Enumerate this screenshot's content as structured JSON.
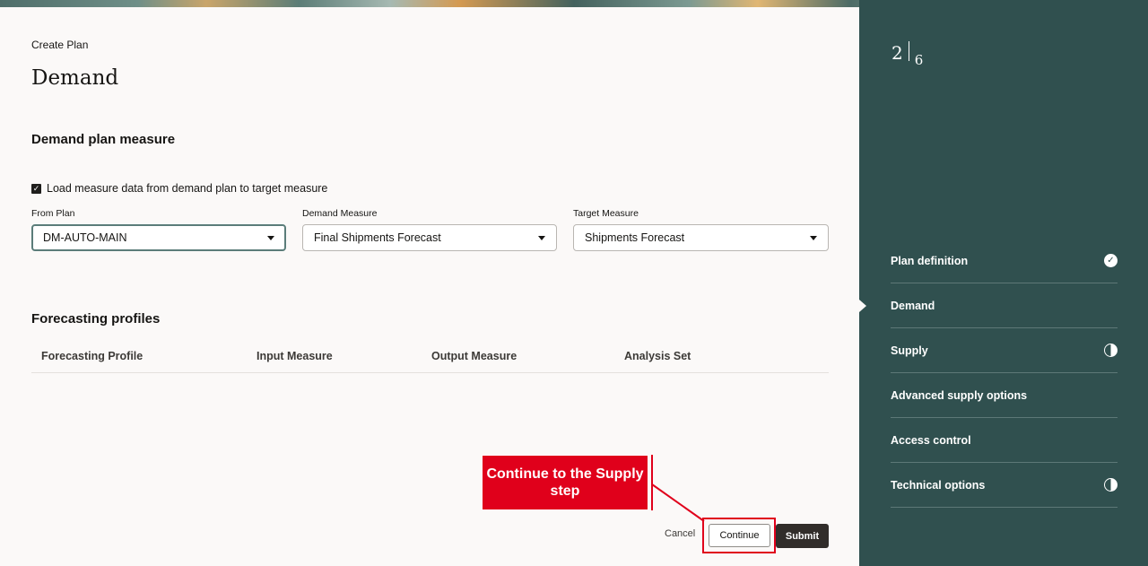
{
  "header": {
    "breadcrumb": "Create Plan",
    "title": "Demand"
  },
  "demand_plan_measure": {
    "section_title": "Demand plan measure",
    "checkbox_label": "Load measure data from demand plan to target measure",
    "checkbox_checked": true,
    "from_plan": {
      "label": "From Plan",
      "value": "DM-AUTO-MAIN"
    },
    "demand_measure": {
      "label": "Demand Measure",
      "value": "Final Shipments Forecast"
    },
    "target_measure": {
      "label": "Target Measure",
      "value": "Shipments Forecast"
    }
  },
  "forecasting_profiles": {
    "section_title": "Forecasting profiles",
    "columns": [
      "Forecasting Profile",
      "Input Measure",
      "Output Measure",
      "Analysis Set"
    ]
  },
  "actions": {
    "cancel": "Cancel",
    "continue": "Continue",
    "submit": "Submit"
  },
  "callout": {
    "text": "Continue to the Supply step",
    "color": "#e0001b"
  },
  "train": {
    "current": "2",
    "total": "6",
    "steps": [
      {
        "label": "Plan definition",
        "status": "complete",
        "icon": "check-circle-icon"
      },
      {
        "label": "Demand",
        "status": "current",
        "icon": ""
      },
      {
        "label": "Supply",
        "status": "partial",
        "icon": "half-circle-icon"
      },
      {
        "label": "Advanced supply options",
        "status": "none",
        "icon": ""
      },
      {
        "label": "Access control",
        "status": "none",
        "icon": ""
      },
      {
        "label": "Technical options",
        "status": "partial",
        "icon": "half-circle-icon"
      }
    ]
  },
  "colors": {
    "side_panel": "#30504f",
    "primary_button": "#312d2a",
    "accent_red": "#e0001b"
  }
}
